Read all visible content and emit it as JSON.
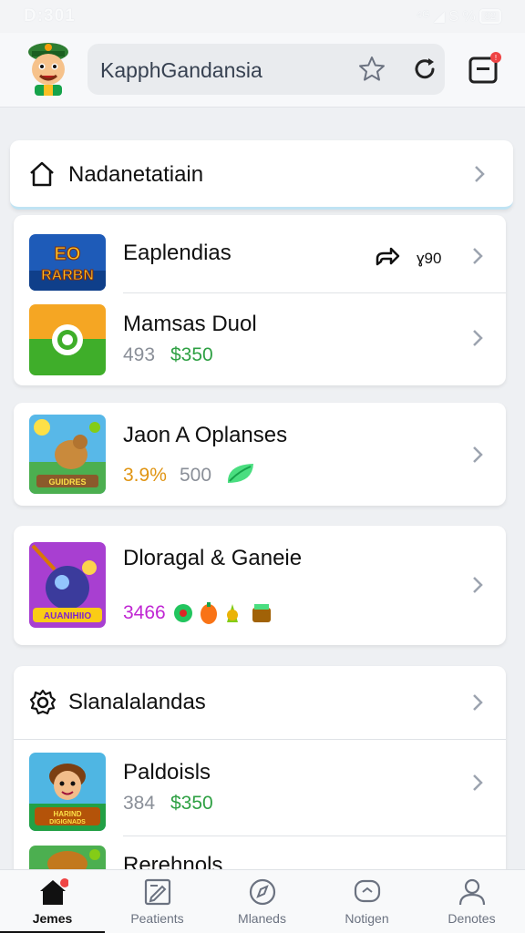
{
  "status_bar": {
    "time": "D:301",
    "icons_text": "⁴ᴳ ◢ S %",
    "battery": "82"
  },
  "header": {
    "search_text": "KapphGandansia",
    "avatar_icon": "cartoon-avatar-icon",
    "star_icon": "star-icon",
    "reload_icon": "reload-icon",
    "tabs_icon": "tabs-icon",
    "notification_color": "#ef4444"
  },
  "nav_card": {
    "title": "Nadanetatiain",
    "icon": "home-icon"
  },
  "list": [
    {
      "title": "Eaplendias",
      "meta": [],
      "trailing_icon": "share-arrow-icon",
      "trailing_text": "ɣ90",
      "thumb": "game-logo-thumbnail"
    },
    {
      "title": "Mamsas Duol",
      "meta": [
        {
          "text": "493",
          "color": "grey"
        },
        {
          "text": "$350",
          "color": "green"
        }
      ],
      "thumb": "green-orange-icon"
    },
    {
      "title": "Jaon A Oplanses",
      "meta": [
        {
          "text": "3.9%",
          "color": "orange"
        },
        {
          "text": "500",
          "color": "grey"
        }
      ],
      "thumb": "farm-game-thumbnail"
    },
    {
      "title": "Dloragal & Ganeie",
      "meta": [
        {
          "text": "3466",
          "color": "magenta"
        }
      ],
      "thumb": "purple-bomb-game-thumbnail"
    }
  ],
  "settings_section": {
    "title": "Slanalalandas",
    "icon": "gear-icon"
  },
  "settings_list": [
    {
      "title": "Paldoisls",
      "meta": [
        {
          "text": "384",
          "color": "grey"
        },
        {
          "text": "$350",
          "color": "green"
        }
      ],
      "thumb": "character-game-thumbnail"
    },
    {
      "title": "Rerehnols",
      "thumb": "partial-game-thumbnail"
    }
  ],
  "bottom_nav": [
    {
      "label": "Jemes",
      "icon": "home-filled-icon",
      "active": true
    },
    {
      "label": "Peatients",
      "icon": "edit-icon",
      "active": false
    },
    {
      "label": "Mlaneds",
      "icon": "compass-icon",
      "active": false
    },
    {
      "label": "Notigen",
      "icon": "chat-icon",
      "active": false
    },
    {
      "label": "Denotes",
      "icon": "profile-icon",
      "active": false
    }
  ],
  "colors": {
    "accent_green": "#2ea043",
    "active_nav": "#111111",
    "badge": "#ef4444"
  }
}
